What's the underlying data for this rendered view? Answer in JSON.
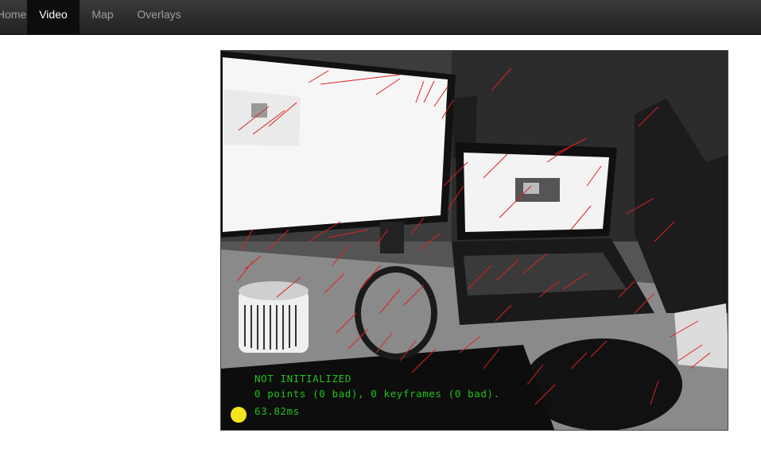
{
  "nav": {
    "items": [
      {
        "id": "home",
        "label": "Home"
      },
      {
        "id": "video",
        "label": "Video"
      },
      {
        "id": "map",
        "label": "Map"
      },
      {
        "id": "overlays",
        "label": "Overlays"
      }
    ],
    "active": "Video"
  },
  "video": {
    "status_text": "NOT INITIALIZED",
    "points_text": "0 points (0 bad), 0 keyframes (0 bad).",
    "time_text": "63.82ms",
    "indicator_color": "#f5e51e",
    "overlay_text_color": "#22c11d",
    "track_line_color": "#e02020"
  }
}
